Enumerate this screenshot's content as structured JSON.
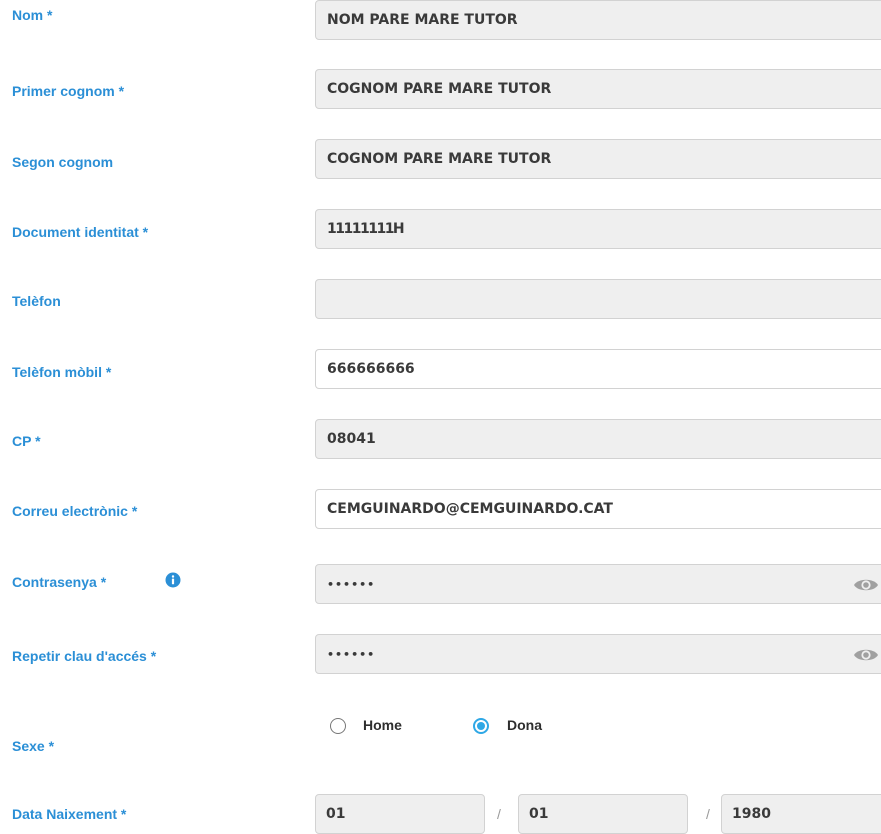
{
  "form": {
    "nom": {
      "label": "Nom *",
      "value": "NOM PARE MARE TUTOR"
    },
    "primer_cognom": {
      "label": "Primer cognom *",
      "value": "COGNOM PARE MARE TUTOR"
    },
    "segon_cognom": {
      "label": "Segon cognom",
      "value": "COGNOM PARE MARE TUTOR"
    },
    "document": {
      "label": "Document identitat *",
      "value": "11111111H"
    },
    "telefon": {
      "label": "Telèfon",
      "value": ""
    },
    "mobil": {
      "label": "Telèfon mòbil *",
      "value": "666666666"
    },
    "cp": {
      "label": "CP *",
      "value": "08041"
    },
    "correu": {
      "label": "Correu electrònic *",
      "value": "CEMGUINARDO@CEMGUINARDO.CAT"
    },
    "contrasenya": {
      "label": "Contrasenya *",
      "value": "••••••",
      "info_icon": "info-circle-icon",
      "toggle_icon": "eye-icon"
    },
    "repetir": {
      "label": "Repetir clau d'accés *",
      "value": "••••••",
      "toggle_icon": "eye-icon"
    },
    "sexe": {
      "label": "Sexe *",
      "options": [
        {
          "label": "Home",
          "selected": false
        },
        {
          "label": "Dona",
          "selected": true
        }
      ]
    },
    "data_naixement": {
      "label": "Data Naixement *",
      "day": "01",
      "month": "01",
      "year": "1980",
      "separator": "/"
    }
  },
  "colors": {
    "label": "#2b8fd6",
    "field_disabled_bg": "#efefef",
    "field_enabled_bg": "#ffffff",
    "field_border": "#d2d2d2",
    "radio_accent": "#2fa8e6",
    "info_icon": "#2b8fd6"
  }
}
